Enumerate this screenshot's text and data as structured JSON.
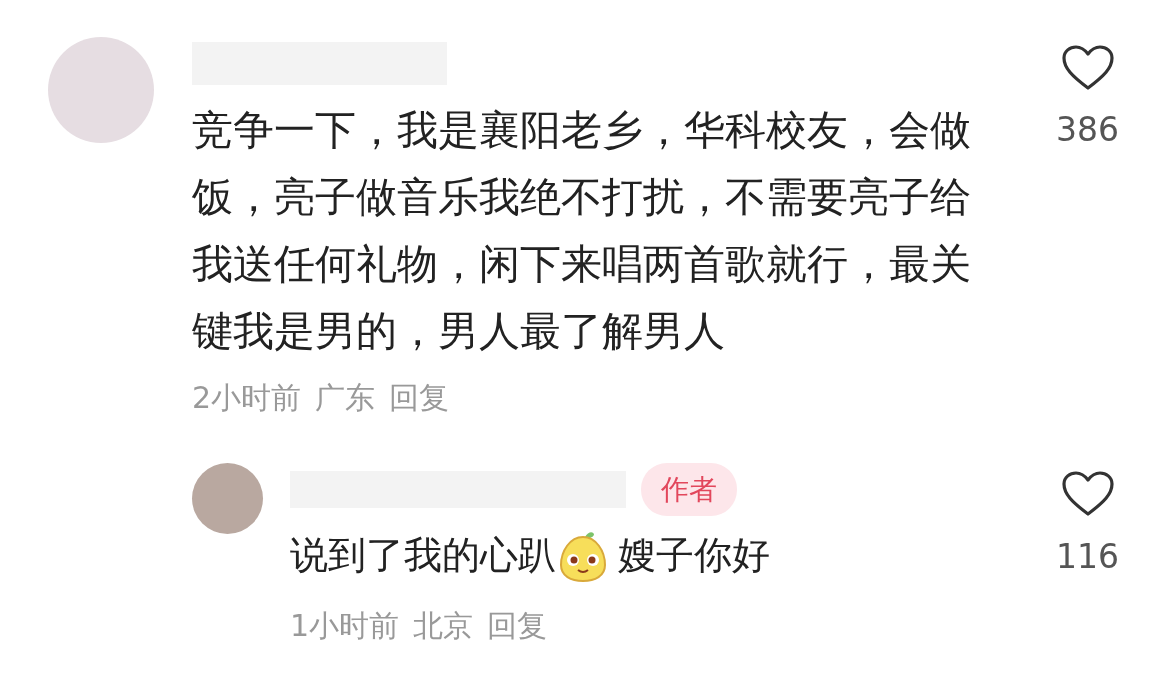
{
  "comments": [
    {
      "text": "竞争一下，我是襄阳老乡，华科校友，会做饭，亮子做音乐我绝不打扰，不需要亮子给我送任何礼物，闲下来唱两首歌就行，最关键我是男的，男人最了解男人",
      "time": "2小时前",
      "location": "广东",
      "reply_label": "回复",
      "likes": "386",
      "replies": [
        {
          "badge": "作者",
          "text": "说到了我的心趴",
          "text_after": "嫂子你好",
          "time": "1小时前",
          "location": "北京",
          "reply_label": "回复",
          "likes": "116"
        }
      ]
    }
  ]
}
